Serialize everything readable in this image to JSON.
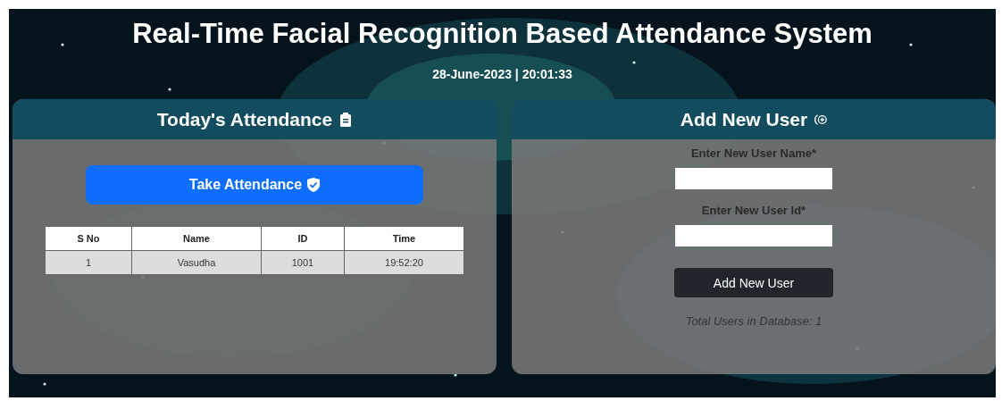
{
  "title": "Real-Time Facial Recognition Based Attendance System",
  "datetime": "28-June-2023 | 20:01:33",
  "attendance": {
    "heading": "Today's Attendance",
    "button": "Take Attendance",
    "table": {
      "columns": [
        "S No",
        "Name",
        "ID",
        "Time"
      ],
      "rows": [
        [
          "1",
          "Vasudha",
          "1001",
          "19:52:20"
        ]
      ]
    }
  },
  "add_user": {
    "heading": "Add New User",
    "fields": [
      {
        "label": "Enter New User Name*"
      },
      {
        "label": "Enter New User Id*"
      }
    ],
    "button": "Add New User",
    "total": "Total Users in Database: 1"
  }
}
